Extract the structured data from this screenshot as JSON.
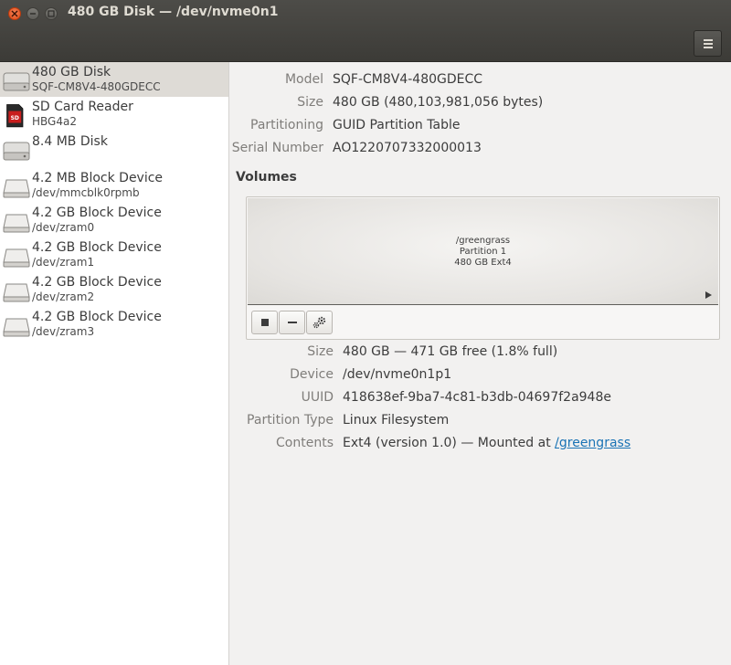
{
  "window": {
    "title": "480 GB Disk — /dev/nvme0n1"
  },
  "sidebar": {
    "items": [
      {
        "name": "480 GB Disk",
        "sub": "SQF-CM8V4-480GDECC",
        "icon": "hard-disk-icon"
      },
      {
        "name": "SD Card Reader",
        "sub": "HBG4a2",
        "icon": "sd-card-icon"
      },
      {
        "name": "8.4 MB Disk",
        "sub": "",
        "icon": "hard-disk-icon"
      },
      {
        "name": "4.2 MB Block Device",
        "sub": "/dev/mmcblk0rpmb",
        "icon": "block-device-icon"
      },
      {
        "name": "4.2 GB Block Device",
        "sub": "/dev/zram0",
        "icon": "block-device-icon"
      },
      {
        "name": "4.2 GB Block Device",
        "sub": "/dev/zram1",
        "icon": "block-device-icon"
      },
      {
        "name": "4.2 GB Block Device",
        "sub": "/dev/zram2",
        "icon": "block-device-icon"
      },
      {
        "name": "4.2 GB Block Device",
        "sub": "/dev/zram3",
        "icon": "block-device-icon"
      }
    ],
    "selected_index": 0
  },
  "disk": {
    "model_label": "Model",
    "model": "SQF-CM8V4-480GDECC",
    "size_label": "Size",
    "size": "480 GB (480,103,981,056 bytes)",
    "partitioning_label": "Partitioning",
    "partitioning": "GUID Partition Table",
    "serial_label": "Serial Number",
    "serial": "AO1220707332000013"
  },
  "volumes": {
    "title": "Volumes",
    "segment": {
      "line1": "/greengrass",
      "line2": "Partition 1",
      "line3": "480 GB Ext4"
    }
  },
  "partition": {
    "size_label": "Size",
    "size": "480 GB — 471 GB free (1.8% full)",
    "device_label": "Device",
    "device": "/dev/nvme0n1p1",
    "uuid_label": "UUID",
    "uuid": "418638ef-9ba7-4c81-b3db-04697f2a948e",
    "type_label": "Partition Type",
    "type": "Linux Filesystem",
    "contents_label": "Contents",
    "contents": "Ext4 (version 1.0) — Mounted at ",
    "mount_link": "/greengrass"
  },
  "colors": {
    "accent": "#df4b16",
    "link": "#1a73b5",
    "titlebar": "#3c3b37"
  }
}
